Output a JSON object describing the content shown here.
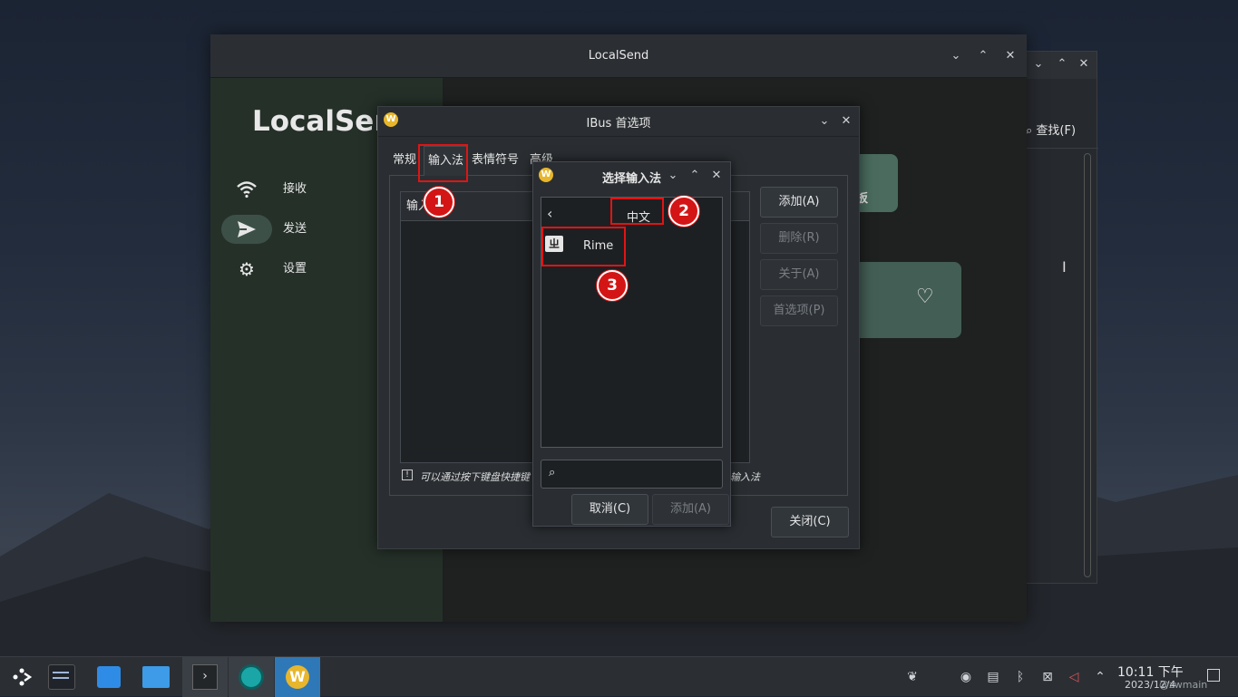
{
  "localsend": {
    "window_title": "LocalSend",
    "app_name": "LocalSend",
    "nav": [
      {
        "label": "接收",
        "icon": "wifi-icon"
      },
      {
        "label": "发送",
        "icon": "send-icon"
      },
      {
        "label": "设置",
        "icon": "gear-icon"
      }
    ],
    "card_text": "板"
  },
  "bg_window": {
    "search_label": "查找(F)"
  },
  "ibus": {
    "title": "IBus 首选项",
    "tabs": [
      "常规",
      "输入法",
      "表情符号",
      "高级"
    ],
    "list_header": "输入",
    "hint_left": "可以通过按下键盘快捷键",
    "hint_right": "输入法",
    "buttons": {
      "add": "添加(A)",
      "remove": "删除(R)",
      "about": "关于(A)",
      "prefs": "首选项(P)",
      "close": "关闭(C)"
    }
  },
  "chooser": {
    "title": "选择输入法",
    "language": "中文",
    "items": [
      {
        "label": "Rime"
      }
    ],
    "search_placeholder": "",
    "cancel": "取消(C)",
    "add": "添加(A)"
  },
  "annotations": [
    "1",
    "2",
    "3"
  ],
  "clock": {
    "time": "10:11 下午",
    "date": "2023/12/4",
    "watermark": "@zwmain"
  },
  "colors": {
    "accent_red": "#e01414",
    "ibus_logo": "#e8b62c",
    "localsend_sidebar": "#253029"
  }
}
